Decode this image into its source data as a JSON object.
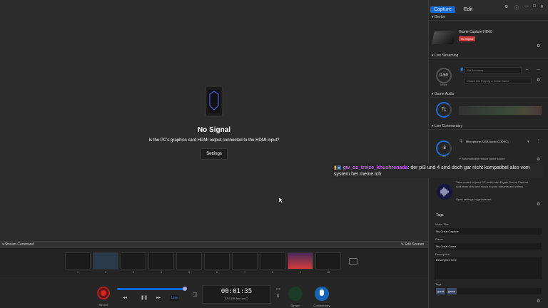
{
  "preview": {
    "nosignal_title": "No Signal",
    "nosignal_message": "Is the PC's graphics card HDMI output connected to the HDMI input?",
    "settings_label": "Settings"
  },
  "stream_command": {
    "title": "Stream Command",
    "edit_label": "Edit Scenes",
    "slots": [
      "1",
      "2",
      "3",
      "4",
      "5",
      "6",
      "7",
      "8",
      "9",
      "10"
    ]
  },
  "transport": {
    "record_label": "Record",
    "live_label": "Live",
    "timer": "00:01:35",
    "free_space": "37.6 GB free on C:",
    "stream_label": "Stream",
    "commentary_label": "Commentary"
  },
  "side": {
    "tabs": [
      "Capture",
      "Edit"
    ],
    "device": {
      "header": "Device",
      "name": "Game Capture HD60",
      "status": "No Signal"
    },
    "live_streaming": {
      "header": "Live Streaming",
      "bitrate": "0.50",
      "bitrate_unit": "Mbps",
      "account": "No Accounts",
      "title_placeholder": "Watch Me Playing a Great Game"
    },
    "game_audio": {
      "header": "Game Audio",
      "value": "71"
    },
    "live_commentary": {
      "header": "Live Commentary",
      "value": "-8",
      "unit": "dB",
      "device": "Microphone (USB Audio CODEC)",
      "reduce": "Automatically reduce game sound"
    },
    "sound_capture": {
      "text": "Take control of your PC audio with Elgato Sound Capture. Add team chat and music to your streams and videos.",
      "link": "Open settings to get started."
    },
    "tags": {
      "header": "Tags",
      "video_title_label": "Video Title",
      "video_title": "My Great Capture",
      "game_label": "Game",
      "game": "My Great Game",
      "description_label": "Description",
      "description": "Description here",
      "tags_label": "Tags",
      "tag_list": [
        "great",
        "game"
      ]
    }
  },
  "chat": {
    "username": "gw_oz_treize_khushrenada",
    "message": "der pi3 und 4 sind doch gar nicht kompatibel also vom system her meine ich"
  }
}
